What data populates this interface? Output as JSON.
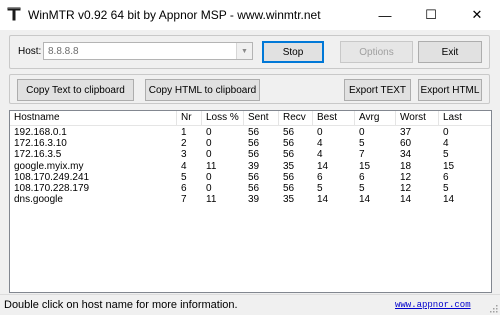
{
  "window": {
    "title": "WinMTR v0.92 64 bit by Appnor MSP - www.winmtr.net",
    "icon": "winmtr-app-icon",
    "minimize_glyph": "—",
    "maximize_glyph": "☐",
    "close_glyph": "✕"
  },
  "host": {
    "label": "Host:",
    "value": "8.8.8.8"
  },
  "buttons": {
    "stop": "Stop",
    "options": "Options",
    "exit": "Exit",
    "copy_text": "Copy Text to clipboard",
    "copy_html": "Copy HTML to clipboard",
    "export_text": "Export TEXT",
    "export_html": "Export HTML"
  },
  "table": {
    "columns": [
      "Hostname",
      "Nr",
      "Loss %",
      "Sent",
      "Recv",
      "Best",
      "Avrg",
      "Worst",
      "Last"
    ],
    "rows": [
      [
        "192.168.0.1",
        "1",
        "0",
        "56",
        "56",
        "0",
        "0",
        "37",
        "0"
      ],
      [
        "172.16.3.10",
        "2",
        "0",
        "56",
        "56",
        "4",
        "5",
        "60",
        "4"
      ],
      [
        "172.16.3.5",
        "3",
        "0",
        "56",
        "56",
        "4",
        "7",
        "34",
        "5"
      ],
      [
        "google.myix.my",
        "4",
        "11",
        "39",
        "35",
        "14",
        "15",
        "18",
        "15"
      ],
      [
        "108.170.249.241",
        "5",
        "0",
        "56",
        "56",
        "6",
        "6",
        "12",
        "6"
      ],
      [
        "108.170.228.179",
        "6",
        "0",
        "56",
        "56",
        "5",
        "5",
        "12",
        "5"
      ],
      [
        "dns.google",
        "7",
        "11",
        "39",
        "35",
        "14",
        "14",
        "14",
        "14"
      ]
    ]
  },
  "status": {
    "message": "Double click on host name for more information.",
    "link": "www.appnor.com"
  }
}
